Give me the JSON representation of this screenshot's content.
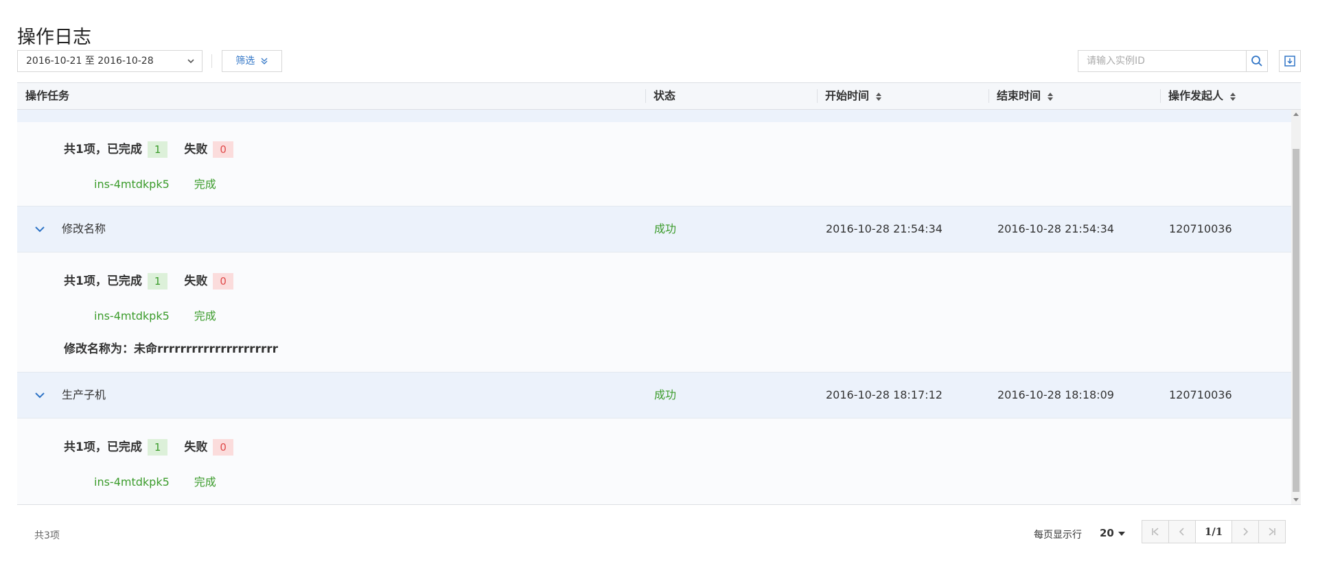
{
  "page": {
    "title": "操作日志"
  },
  "toolbar": {
    "date_range": "2016-10-21 至 2016-10-28",
    "filter_label": "筛选",
    "search_placeholder": "请输入实例ID"
  },
  "table": {
    "headers": {
      "task": "操作任务",
      "status": "状态",
      "start": "开始时间",
      "end": "结束时间",
      "operator": "操作发起人"
    },
    "detail_labels": {
      "total_done": "共1项，已完成",
      "failed": "失败"
    },
    "top_detail": {
      "done_count": "1",
      "fail_count": "0",
      "instance": "ins-4mtdkpk5",
      "instance_status": "完成"
    },
    "rows": [
      {
        "task": "修改名称",
        "status": "成功",
        "start": "2016-10-28 21:54:34",
        "end": "2016-10-28 21:54:34",
        "operator": "120710036",
        "detail": {
          "done_count": "1",
          "fail_count": "0",
          "instance": "ins-4mtdkpk5",
          "instance_status": "完成",
          "note": "修改名称为：未命rrrrrrrrrrrrrrrrrrrrr"
        }
      },
      {
        "task": "生产子机",
        "status": "成功",
        "start": "2016-10-28 18:17:12",
        "end": "2016-10-28 18:18:09",
        "operator": "120710036",
        "detail": {
          "done_count": "1",
          "fail_count": "0",
          "instance": "ins-4mtdkpk5",
          "instance_status": "完成"
        }
      }
    ]
  },
  "footer": {
    "total": "共3项",
    "per_page_label": "每页显示行",
    "per_page_value": "20",
    "page_indicator": "1/1"
  },
  "colors": {
    "success_green": "#3a9b2a",
    "fail_red": "#e04b4b",
    "link_blue": "#2f74c6",
    "row_highlight": "#ecf2fb"
  },
  "icons": [
    "chevron-down-icon",
    "double-chevron-down-icon",
    "search-icon",
    "download-icon",
    "sort-icon",
    "first-page-icon",
    "prev-page-icon",
    "next-page-icon",
    "last-page-icon"
  ]
}
